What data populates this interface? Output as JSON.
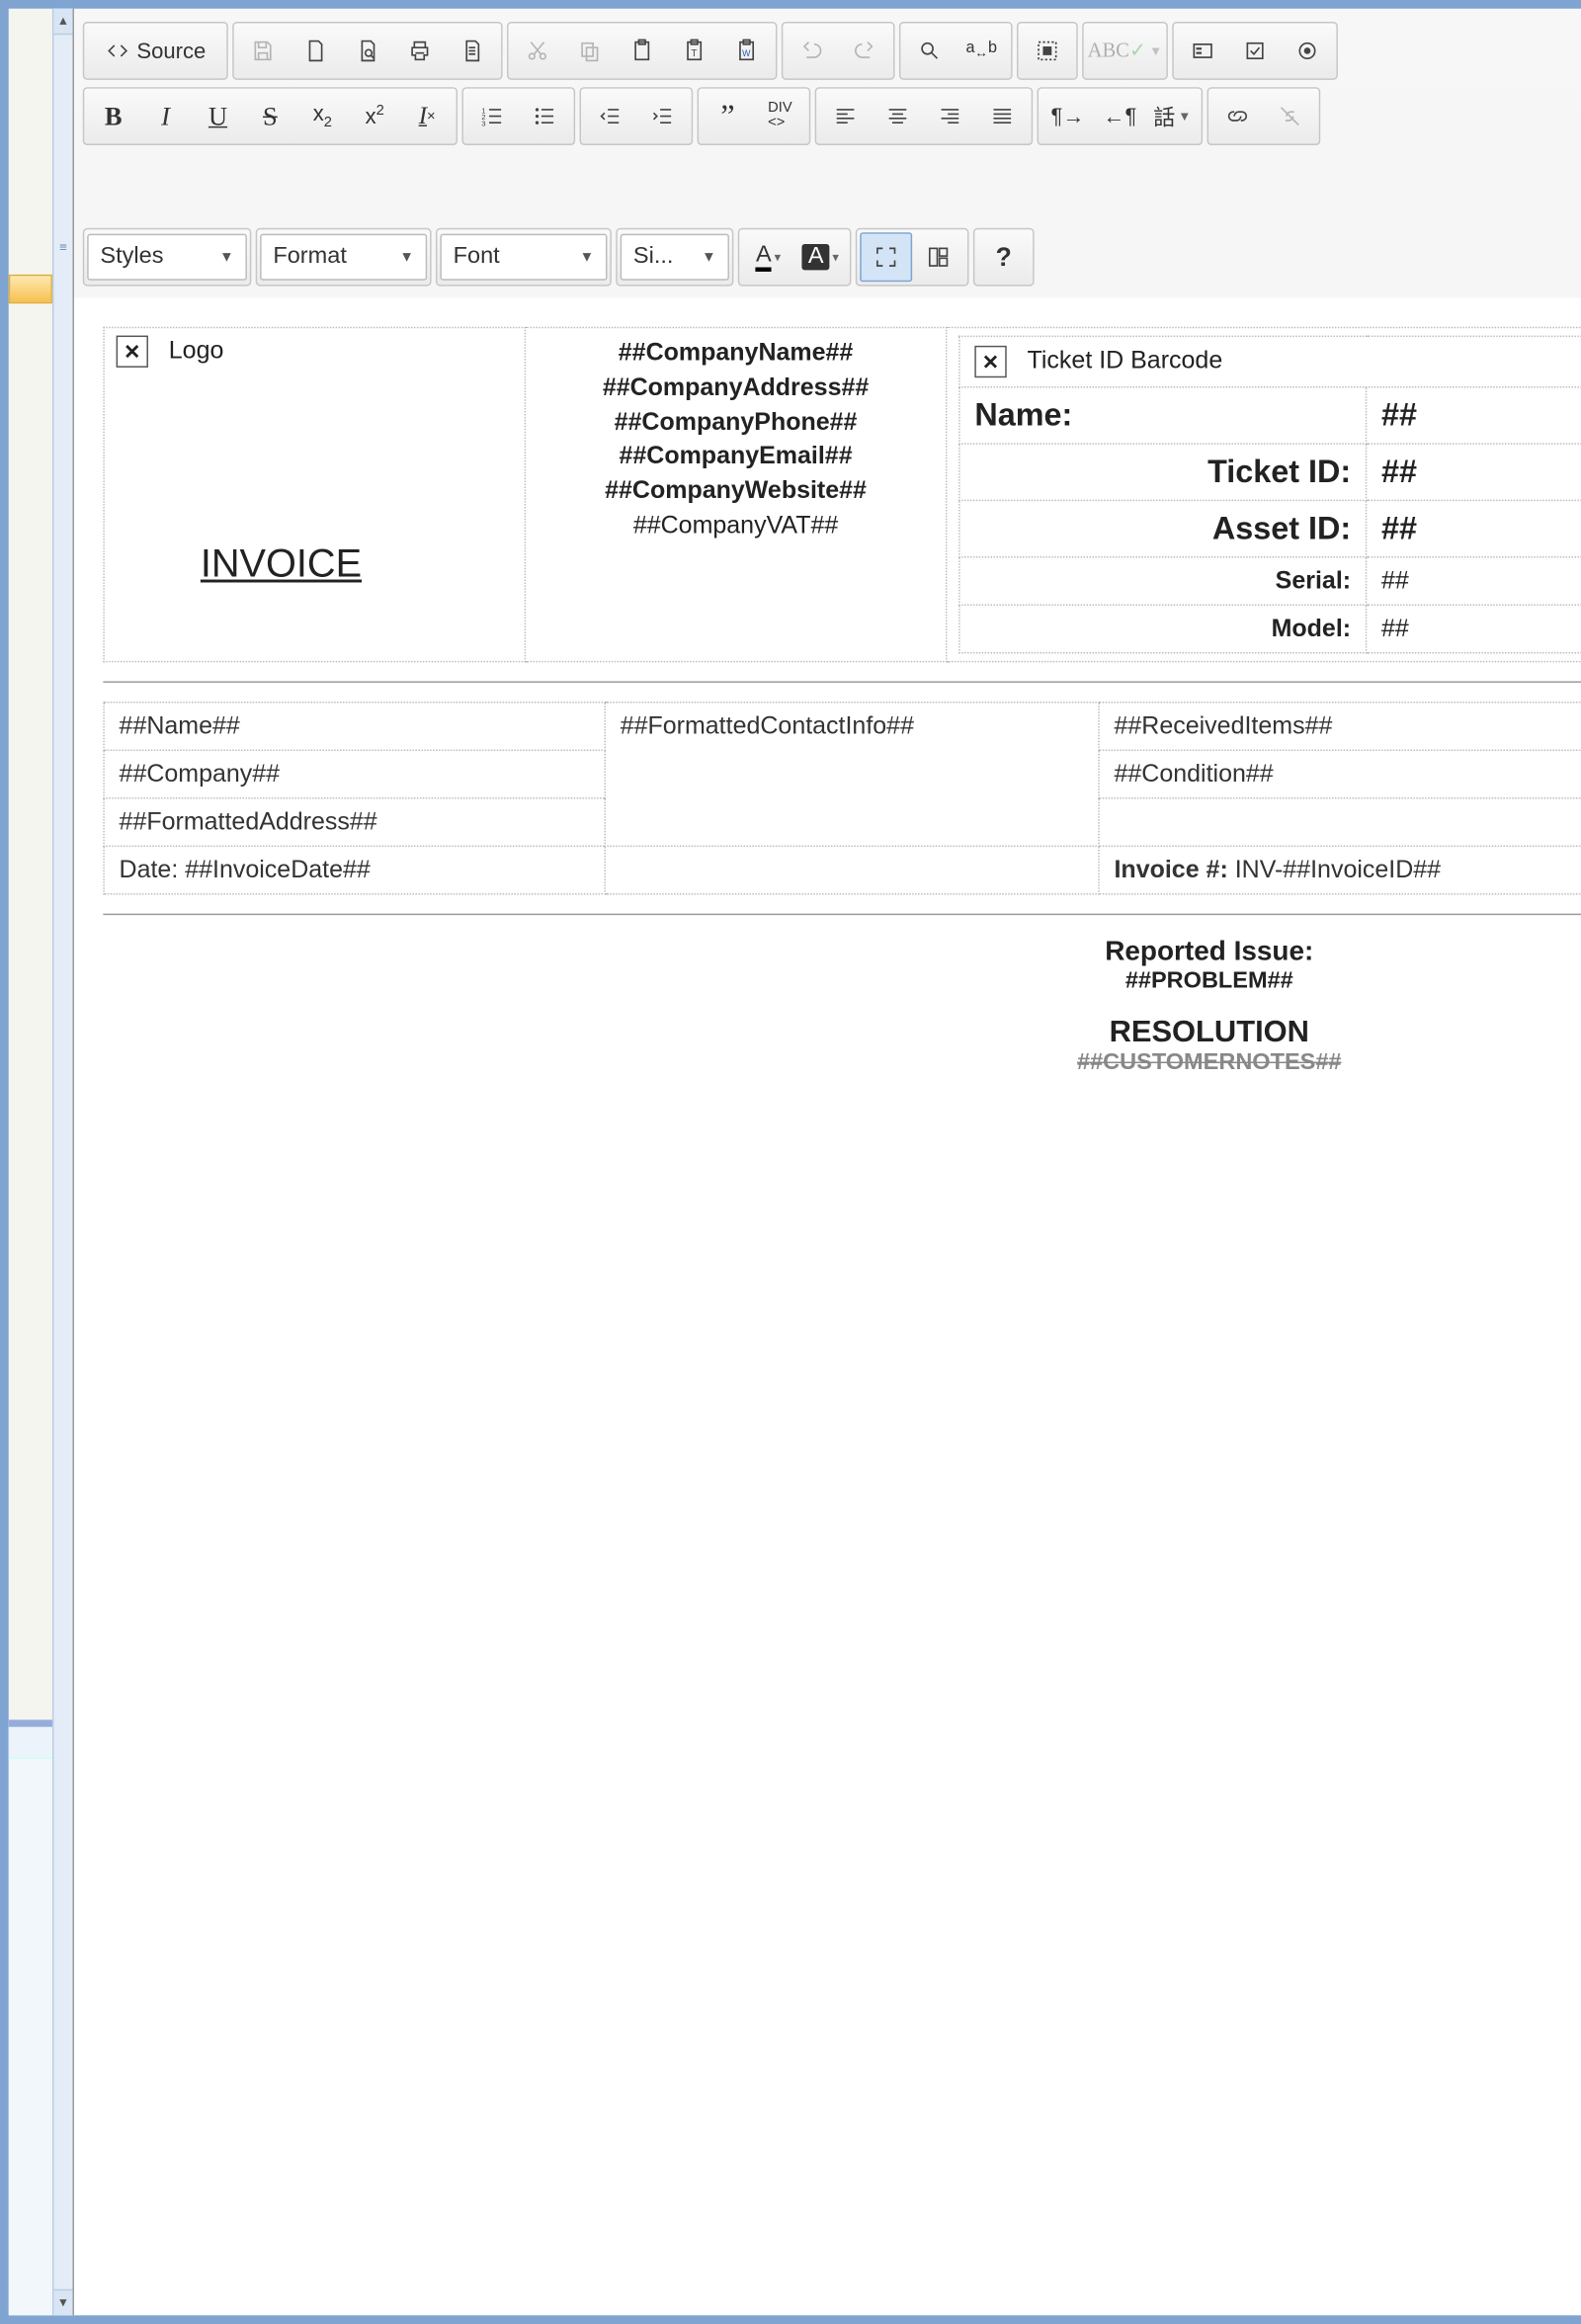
{
  "toolbar": {
    "source": "Source",
    "styles": "Styles",
    "format": "Format",
    "font": "Font",
    "size": "Si..."
  },
  "header": {
    "logo_label": "Logo",
    "company": {
      "name": "##CompanyName##",
      "address": "##CompanyAddress##",
      "phone": "##CompanyPhone##",
      "email": "##CompanyEmail##",
      "website": "##CompanyWebsite##",
      "vat": "##CompanyVAT##"
    },
    "barcode_label": "Ticket ID Barcode"
  },
  "info": {
    "name_label": "Name:",
    "name_val": "##",
    "ticket_label": "Ticket ID:",
    "ticket_val": "##",
    "asset_label": "Asset ID:",
    "asset_val": "##",
    "serial_label": "Serial:",
    "serial_val": "##",
    "model_label": "Model:",
    "model_val": "##"
  },
  "titles": {
    "invoice": "INVOICE"
  },
  "customer": {
    "name": "##Name##",
    "company": "##Company##",
    "address": "##FormattedAddress##",
    "date_label": "Date: ",
    "date_val": "##InvoiceDate##",
    "contact": "##FormattedContactInfo##",
    "received": "##ReceivedItems##",
    "condition": "##Condition##",
    "invoice_num_label": "Invoice #: ",
    "invoice_num_prefix": "INV-",
    "invoice_num_val": "##InvoiceID##"
  },
  "issue": {
    "reported_label": "Reported Issue:",
    "problem": "##PROBLEM##",
    "resolution_label": "RESOLUTION",
    "customer_notes": "##CUSTOMERNOTES##"
  }
}
